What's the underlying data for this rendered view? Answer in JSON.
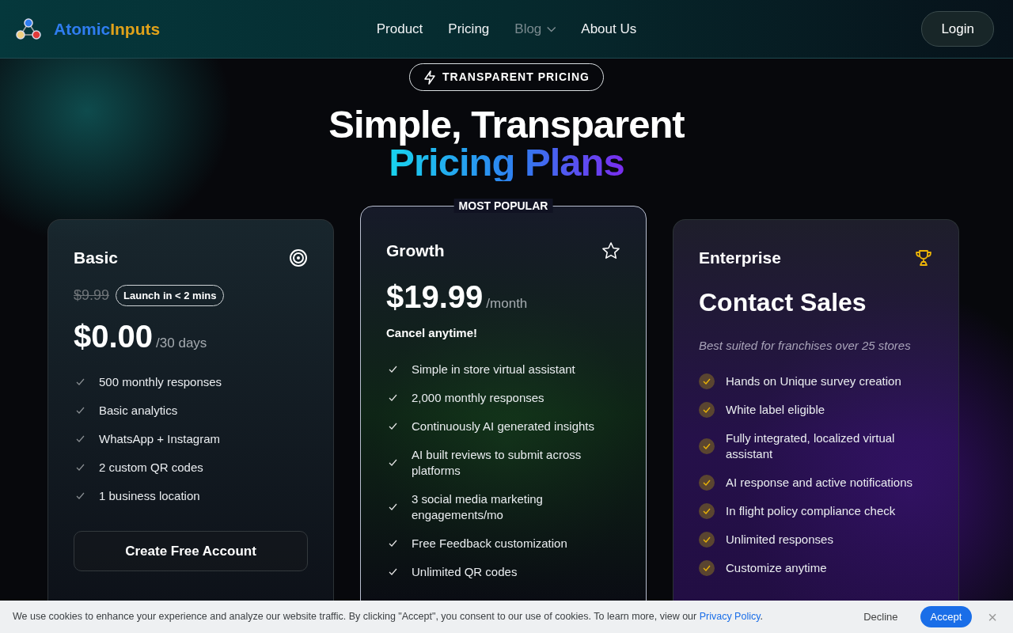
{
  "navbar": {
    "brand": [
      "Atomic",
      "Inputs"
    ],
    "links": [
      {
        "label": "Product",
        "dimmed": false,
        "kind": "link"
      },
      {
        "label": "Pricing",
        "dimmed": false,
        "kind": "link"
      },
      {
        "label": "Blog",
        "dimmed": true,
        "kind": "dropdown"
      },
      {
        "label": "About Us",
        "dimmed": false,
        "kind": "link"
      }
    ],
    "login": "Login"
  },
  "hero": {
    "pill": "TRANSPARENT PRICING",
    "title": "Simple, Transparent",
    "title_gradient": "Pricing Plans"
  },
  "plans": [
    {
      "kind": "basic",
      "name": "Basic",
      "old_price": "$9.99",
      "badge": "Launch in < 2 mins",
      "price": "$0.00",
      "period": "/30 days",
      "features": [
        "500 monthly responses",
        "Basic analytics",
        "WhatsApp + Instagram",
        "2 custom QR codes",
        "1 business location"
      ],
      "button": "Create Free Account"
    },
    {
      "kind": "growth",
      "name": "Growth",
      "ribbon": "MOST POPULAR",
      "price": "$19.99",
      "period": "/month",
      "note": "Cancel anytime!",
      "features": [
        "Simple in store virtual assistant",
        "2,000 monthly responses",
        "Continuously AI generated insights",
        "AI built reviews to submit across platforms",
        "3 social media marketing engagements/mo",
        "Free Feedback customization",
        "Unlimited QR codes"
      ]
    },
    {
      "kind": "enterprise",
      "name": "Enterprise",
      "price": "Contact Sales",
      "subtitle": "Best suited for franchises over 25 stores",
      "features": [
        "Hands on Unique survey creation",
        "White label eligible",
        "Fully integrated, localized virtual assistant",
        "AI response and active notifications",
        "In flight policy compliance check",
        "Unlimited responses",
        "Customize anytime"
      ]
    }
  ],
  "cookie_bar": {
    "message": "We use cookies to enhance your experience and analyze our website traffic. By clicking \"Accept\", you consent to our use of cookies. To learn more, view our ",
    "link": "Privacy Policy",
    "message_end": ".",
    "decline": "Decline",
    "accept": "Accept",
    "close": "×"
  }
}
